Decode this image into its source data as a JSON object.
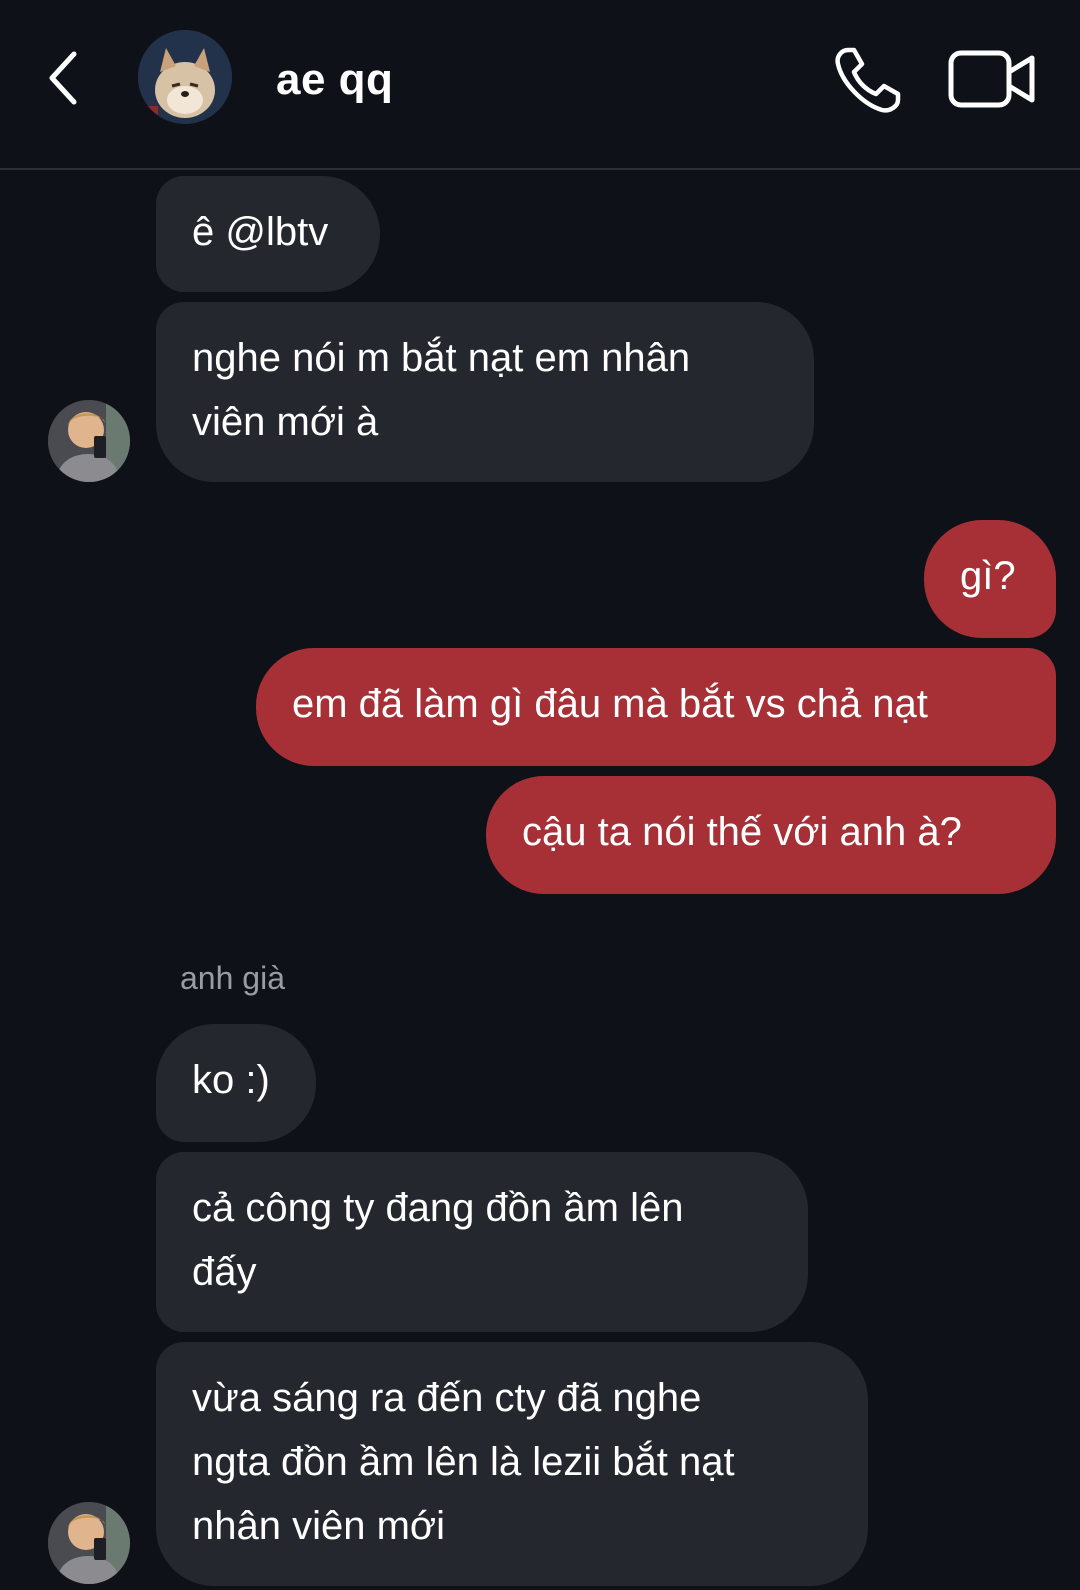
{
  "header": {
    "title": "ae qq",
    "back_icon": "chevron-left-icon",
    "call_icon": "phone-icon",
    "video_icon": "video-camera-icon"
  },
  "messages": {
    "m1": "ê @lbtv",
    "m2_line1": "nghe nói m bắt nạt em nhân",
    "m2_line2": "viên mới à",
    "m3": "gì?",
    "m4": "em đã làm gì đâu mà bắt vs chả nạt",
    "m5": "cậu ta nói thế với anh à?",
    "sender_name": "anh già",
    "m6": "ko :)",
    "m7_line1": "cả công ty đang đồn ầm lên",
    "m7_line2": "đấy",
    "m8_line1": "vừa sáng ra đến cty đã nghe",
    "m8_line2": "ngta đồn ầm lên là lezii bắt nạt",
    "m8_line3": "nhân viên mới"
  },
  "colors": {
    "background": "#0e1118",
    "incoming_bubble": "#25272e",
    "outgoing_bubble": "#a63036",
    "sender_name": "#9a9ca3"
  }
}
